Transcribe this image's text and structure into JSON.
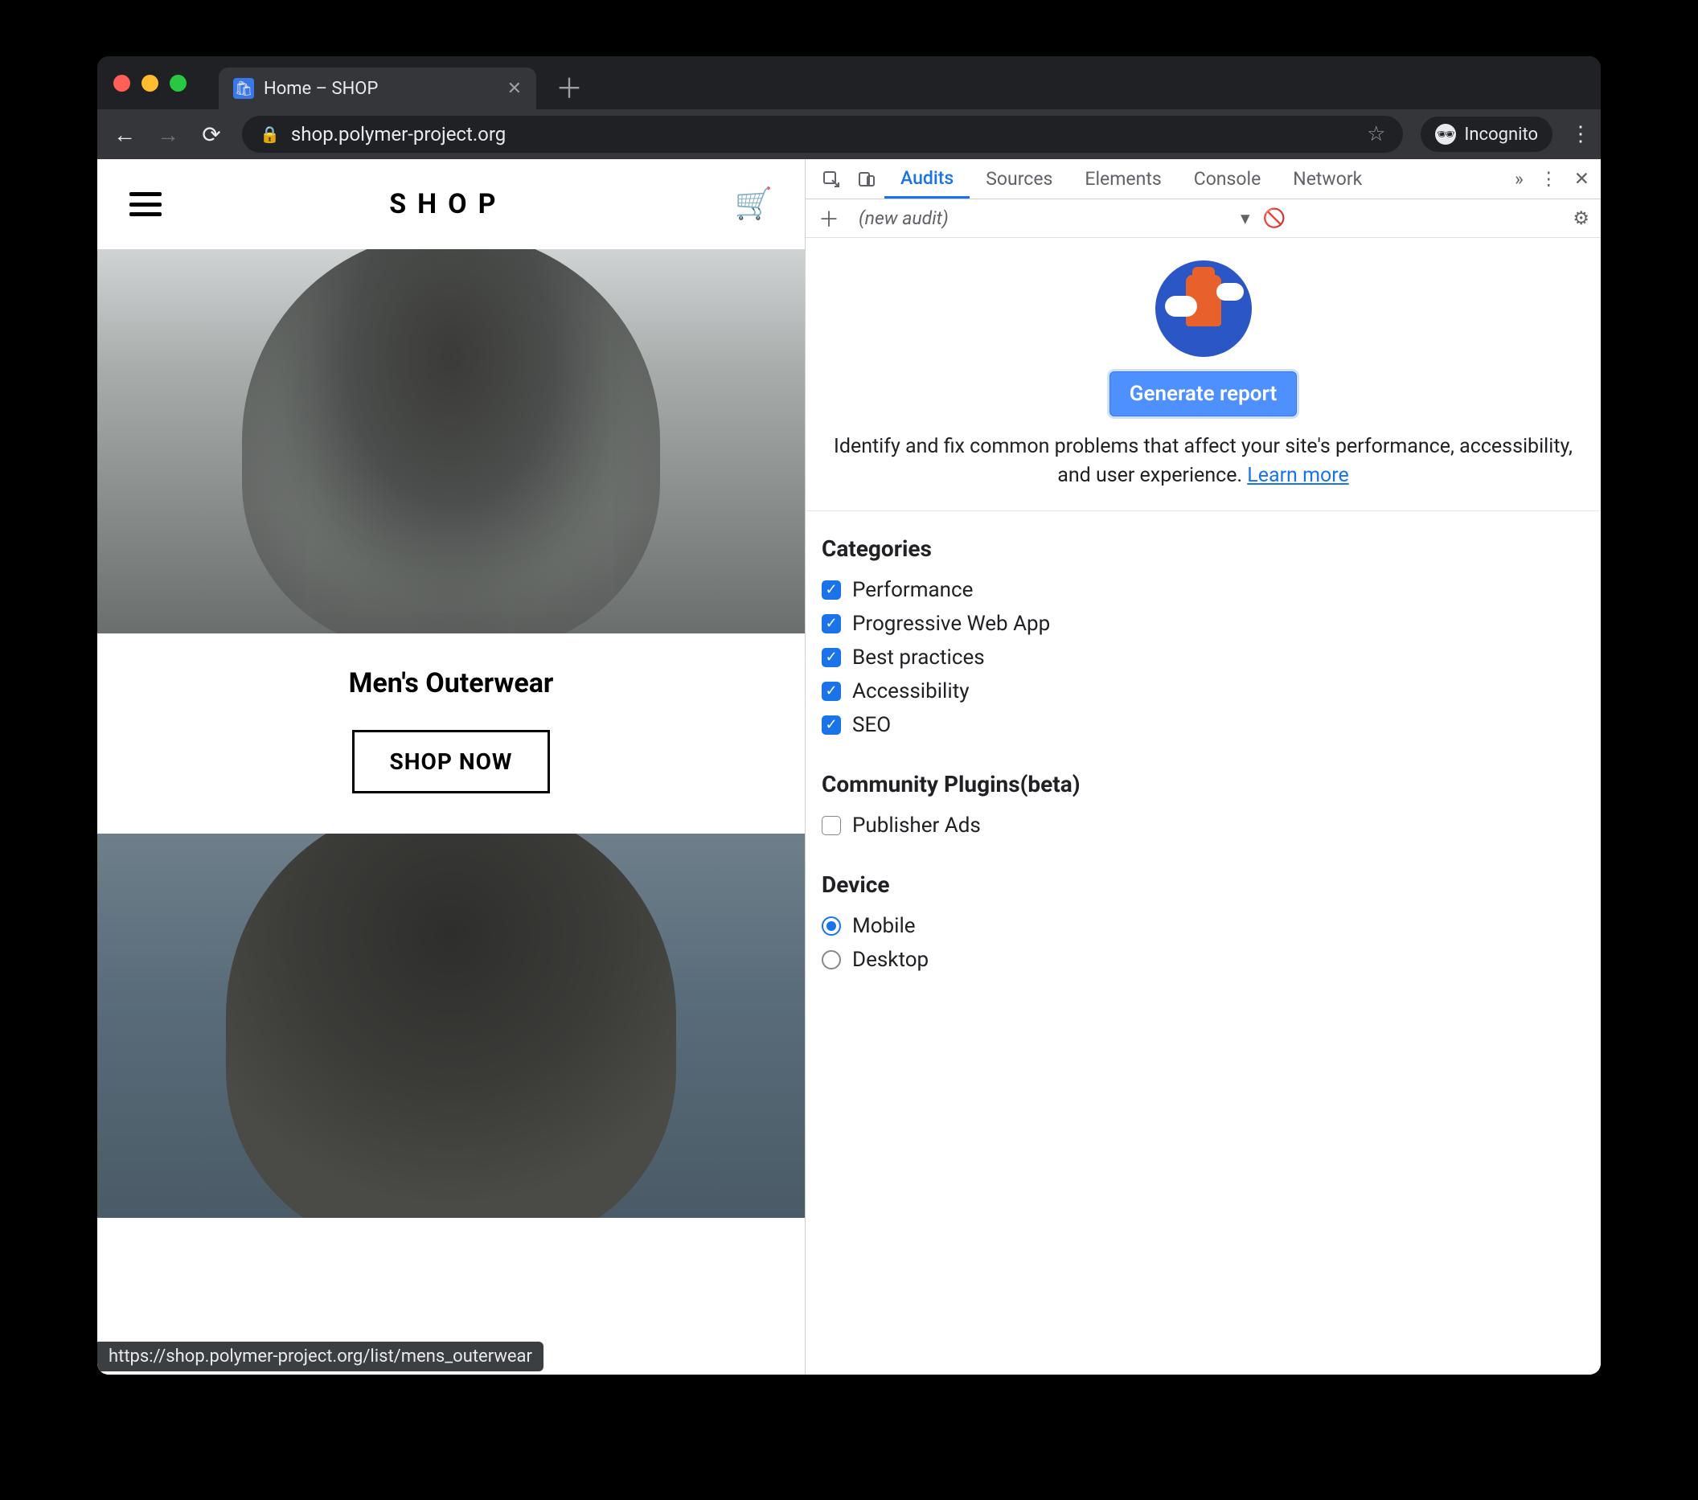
{
  "browser": {
    "tab_title": "Home – SHOP",
    "url_display": "shop.polymer-project.org",
    "incognito_label": "Incognito",
    "status_url": "https://shop.polymer-project.org/list/mens_outerwear"
  },
  "site": {
    "logo": "SHOP",
    "category_title": "Men's Outerwear",
    "shop_now": "SHOP NOW"
  },
  "devtools": {
    "tabs": [
      "Audits",
      "Sources",
      "Elements",
      "Console",
      "Network"
    ],
    "active_tab": "Audits",
    "subbar": {
      "new_audit": "(new audit)"
    },
    "generate_btn": "Generate report",
    "blurb": "Identify and fix common problems that affect your site's performance, accessibility, and user experience. ",
    "learn_more": "Learn more",
    "categories_heading": "Categories",
    "categories": [
      {
        "label": "Performance",
        "checked": true
      },
      {
        "label": "Progressive Web App",
        "checked": true
      },
      {
        "label": "Best practices",
        "checked": true
      },
      {
        "label": "Accessibility",
        "checked": true
      },
      {
        "label": "SEO",
        "checked": true
      }
    ],
    "plugins_heading": "Community Plugins(beta)",
    "plugins": [
      {
        "label": "Publisher Ads",
        "checked": false
      }
    ],
    "device_heading": "Device",
    "devices": [
      {
        "label": "Mobile",
        "selected": true
      },
      {
        "label": "Desktop",
        "selected": false
      }
    ]
  }
}
